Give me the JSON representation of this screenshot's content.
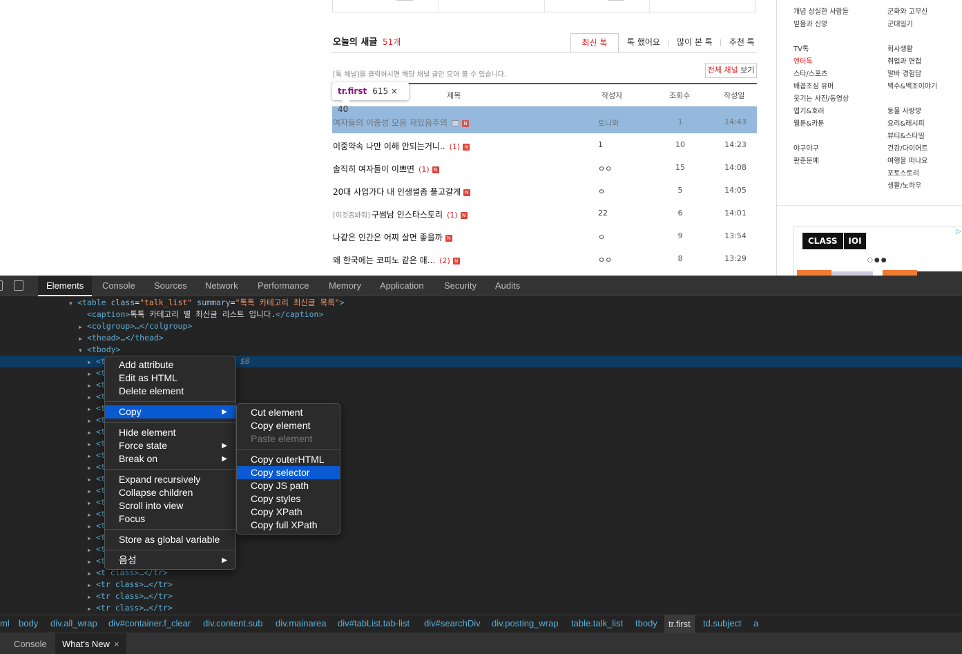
{
  "web": {
    "sidebar_left_col": [
      "개념 상실한 사람들",
      "믿음과 신앙",
      "TV톡",
      "엔터톡",
      "스타/스포츠",
      "배꼽조심 유머",
      "웃기는 사진/동영상",
      "엽기&호러",
      "웹툰&카툰",
      "야구야구",
      "판춘문예"
    ],
    "sidebar_right_col": [
      "군화와 고무신",
      "군대일기",
      "회사생활",
      "취업과 면접",
      "알바 경험담",
      "백수&백조이야기",
      "동물 사랑방",
      "요리&레시피",
      "뷰티&스타일",
      "건강/다이어트",
      "여행을 떠나요",
      "포토스토리",
      "생활/노하우"
    ],
    "ad": {
      "logo1": "CLASS",
      "logo2": "IOI",
      "dots": "○●●"
    },
    "section_title": "오늘의 새글",
    "section_count": "51개",
    "tabs": [
      "최신 톡",
      "톡 했어요",
      "많이 본 톡",
      "추천 톡"
    ],
    "hint": "[톡 채널]을 클릭하시면 해당 채널 글만 모아 볼 수 있습니다.",
    "channel_btn": {
      "red": "전체 채널",
      "rest": " 보기"
    },
    "columns": {
      "subject": "제목",
      "author": "작성자",
      "views": "조회수",
      "date": "작성일"
    },
    "tooltip": {
      "selector": "tr.first",
      "size": "615 × 40"
    },
    "rows": [
      {
        "tag": "",
        "subject": "여자들의 이중성 모음 재밌음주의",
        "comments": "",
        "author": "토니와",
        "views": "1",
        "date": "14:43"
      },
      {
        "tag": "",
        "subject": "이중약속 나만 이해 안되는거니..",
        "comments": "(1)",
        "author": "1",
        "views": "10",
        "date": "14:23"
      },
      {
        "tag": "",
        "subject": "솔직히 여자들이 이쁘면",
        "comments": "(1)",
        "author": "ㅇㅇ",
        "views": "15",
        "date": "14:08"
      },
      {
        "tag": "",
        "subject": "20대 사업가다 내 인생썰좀 풀고갈게",
        "comments": "",
        "author": "ㅇ",
        "views": "5",
        "date": "14:05"
      },
      {
        "tag": "[이것좀봐줘]",
        "subject": "구썸남 인스타스토리",
        "comments": "(1)",
        "author": "22",
        "views": "6",
        "date": "14:01"
      },
      {
        "tag": "",
        "subject": "나같은 인간은 어찌 살면 좋을까",
        "comments": "",
        "author": "ㅇ",
        "views": "9",
        "date": "13:54"
      },
      {
        "tag": "",
        "subject": "왜 한국에는 코피노 같은 애...",
        "comments": "(2)",
        "author": "ㅇㅇ",
        "views": "8",
        "date": "13:29"
      }
    ],
    "badge": "N"
  },
  "devtools": {
    "tabs": [
      "Elements",
      "Console",
      "Sources",
      "Network",
      "Performance",
      "Memory",
      "Application",
      "Security",
      "Audits"
    ],
    "dom": {
      "table_open": {
        "tag": "table",
        "a1": "class",
        "v1": "\"talk_list\"",
        "a2": "summary",
        "v2": "\"톡톡 카테고리 최신글 목록\""
      },
      "caption_open": "<caption>",
      "caption_text": "톡톡 카테고리 별 최신글 리스트 입니다.",
      "caption_close": "</caption>",
      "colgroup": "<colgroup>…</colgroup>",
      "thead": "<thead>…</thead>",
      "tbody": "<tbody>",
      "tr_short": "<t",
      "sel_marker": "$0",
      "tr_partial": "<t  class>…</tr>",
      "tr_full": "<tr class>…</tr>"
    },
    "breadcrumbs": [
      "ml",
      "body",
      "div.all_wrap",
      "div#container.f_clear",
      "div.content.sub",
      "div.mainarea",
      "div#tabList.tab-list",
      "div#searchDiv",
      "div.posting_wrap",
      "table.talk_list",
      "tbody",
      "tr.first",
      "td.subject",
      "a"
    ],
    "drawer_tabs": [
      "Console",
      "What's New"
    ],
    "drawer_close": "×"
  },
  "context_menu": {
    "items": [
      "Add attribute",
      "Edit as HTML",
      "Delete element",
      "Copy",
      "Hide element",
      "Force state",
      "Break on",
      "Expand recursively",
      "Collapse children",
      "Scroll into view",
      "Focus",
      "Store as global variable",
      "음성"
    ],
    "submenu": [
      "Cut element",
      "Copy element",
      "Paste element",
      "Copy outerHTML",
      "Copy selector",
      "Copy JS path",
      "Copy styles",
      "Copy XPath",
      "Copy full XPath"
    ],
    "arrow": "▶"
  }
}
